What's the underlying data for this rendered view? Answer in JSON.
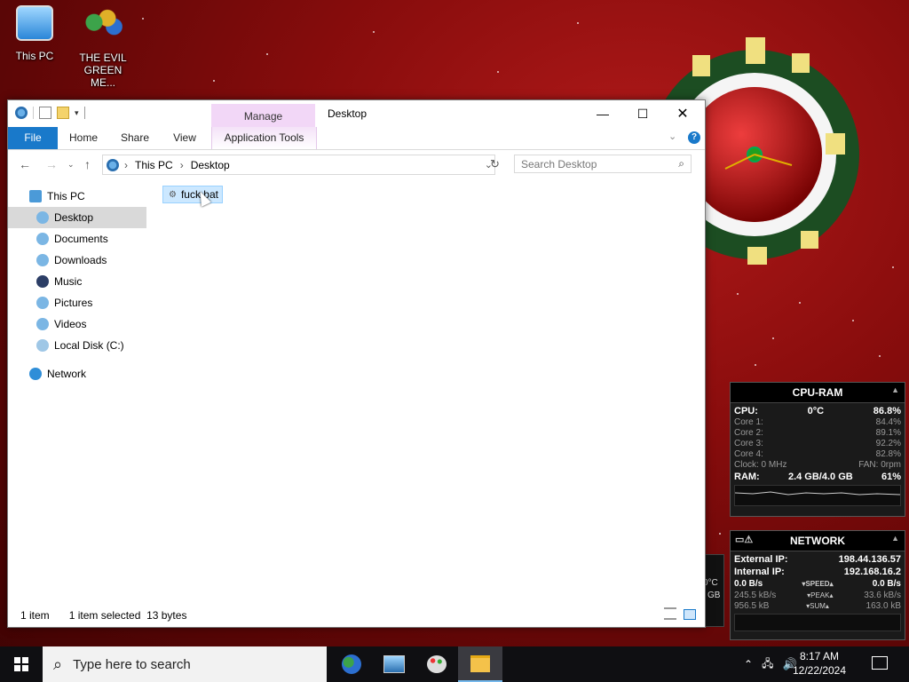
{
  "desktop": {
    "icons": [
      {
        "label": "This PC"
      },
      {
        "label_line1": "THE EVIL",
        "label_line2": "GREEN ME..."
      }
    ]
  },
  "explorer": {
    "manage_tab": "Manage",
    "window_title": "Desktop",
    "ribbon_tabs": [
      "File",
      "Home",
      "Share",
      "View",
      "Application Tools"
    ],
    "breadcrumb": [
      "This PC",
      "Desktop"
    ],
    "search_placeholder": "Search Desktop",
    "nav": {
      "this_pc": "This PC",
      "items": [
        "Desktop",
        "Documents",
        "Downloads",
        "Music",
        "Pictures",
        "Videos",
        "Local Disk (C:)"
      ],
      "network": "Network"
    },
    "file": {
      "name": "fuck.bat"
    },
    "status": {
      "count": "1 item",
      "selected": "1 item selected",
      "size": "13 bytes"
    }
  },
  "cpu_gadget": {
    "title": "CPU-RAM",
    "cpu_label": "CPU:",
    "temp": "0°C",
    "cpu_pct": "86.8%",
    "cores": [
      {
        "label": "Core 1:",
        "value": "84.4%"
      },
      {
        "label": "Core 2:",
        "value": "89.1%"
      },
      {
        "label": "Core 3:",
        "value": "92.2%"
      },
      {
        "label": "Core 4:",
        "value": "82.8%"
      }
    ],
    "clock": "Clock: 0 MHz",
    "fan": "FAN: 0rpm",
    "ram_label": "RAM:",
    "ram_value": "2.4 GB/4.0 GB",
    "ram_pct": "61%"
  },
  "net_gadget": {
    "title": "NETWORK",
    "external_label": "External IP:",
    "external_ip": "198.44.136.57",
    "internal_label": "Internal IP:",
    "internal_ip": "192.168.16.2",
    "speed_in": "0.0 B/s",
    "speed_label": "SPEED",
    "speed_out": "0.0 B/s",
    "peak_in": "245.5 kB/s",
    "peak_label": "PEAK",
    "peak_out": "33.6 kB/s",
    "sum_in": "956.5 kB",
    "sum_label": "SUM",
    "sum_out": "163.0 kB"
  },
  "partial_gadget": {
    "temp": "0°C",
    "unit": "GB"
  },
  "taskbar": {
    "search_placeholder": "Type here to search",
    "time": "8:17 AM",
    "date": "12/22/2024"
  }
}
